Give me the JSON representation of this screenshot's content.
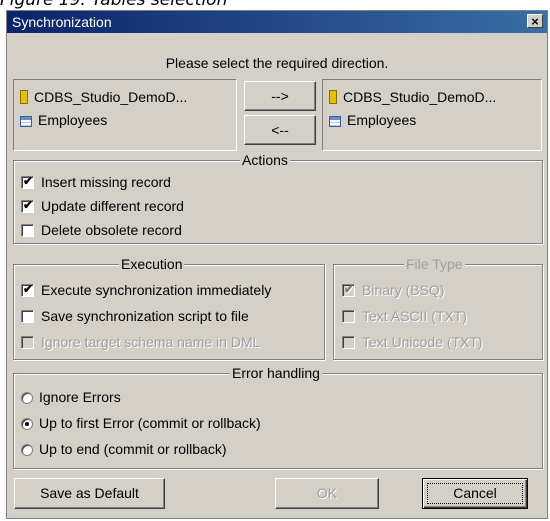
{
  "caption": "Figure 19: Tables selection",
  "dialog": {
    "title": "Synchronization",
    "close_label": "×",
    "prompt": "Please select the required direction."
  },
  "source": {
    "database": "CDBS_Studio_DemoD...",
    "table": "Employees"
  },
  "target": {
    "database": "CDBS_Studio_DemoD...",
    "table": "Employees"
  },
  "direction_buttons": {
    "right": "-->",
    "left": "<--"
  },
  "actions": {
    "legend": "Actions",
    "items": [
      {
        "label": "Insert missing record",
        "checked": true
      },
      {
        "label": "Update different record",
        "checked": true
      },
      {
        "label": "Delete obsolete record",
        "checked": false
      }
    ]
  },
  "execution": {
    "legend": "Execution",
    "items": [
      {
        "label": "Execute synchronization immediately",
        "checked": true,
        "enabled": true
      },
      {
        "label": "Save synchronization script to file",
        "checked": false,
        "enabled": true
      },
      {
        "label": "Ignore target schema name in DML",
        "checked": false,
        "enabled": false
      }
    ]
  },
  "file_type": {
    "legend": "File Type",
    "items": [
      {
        "label": "Binary (BSQ)",
        "checked": true,
        "enabled": false
      },
      {
        "label": "Text ASCII (TXT)",
        "checked": false,
        "enabled": false
      },
      {
        "label": "Text Unicode (TXT)",
        "checked": false,
        "enabled": false
      }
    ]
  },
  "error_handling": {
    "legend": "Error handling",
    "options": [
      {
        "label": "Ignore Errors",
        "selected": false
      },
      {
        "label": "Up to first Error (commit or rollback)",
        "selected": true
      },
      {
        "label": "Up to end (commit or rollback)",
        "selected": false
      }
    ]
  },
  "footer": {
    "save_default": "Save as Default",
    "ok": "OK",
    "cancel": "Cancel"
  },
  "icons": {
    "database": "database-icon",
    "table": "table-icon",
    "check": "check-icon",
    "radio": "radio-dot-icon"
  },
  "colors": {
    "titlebar_start": "#0a246a",
    "titlebar_end": "#3a6ea5",
    "dialog_bg": "#d4d0c8",
    "disabled_text": "#a0a0a0"
  }
}
